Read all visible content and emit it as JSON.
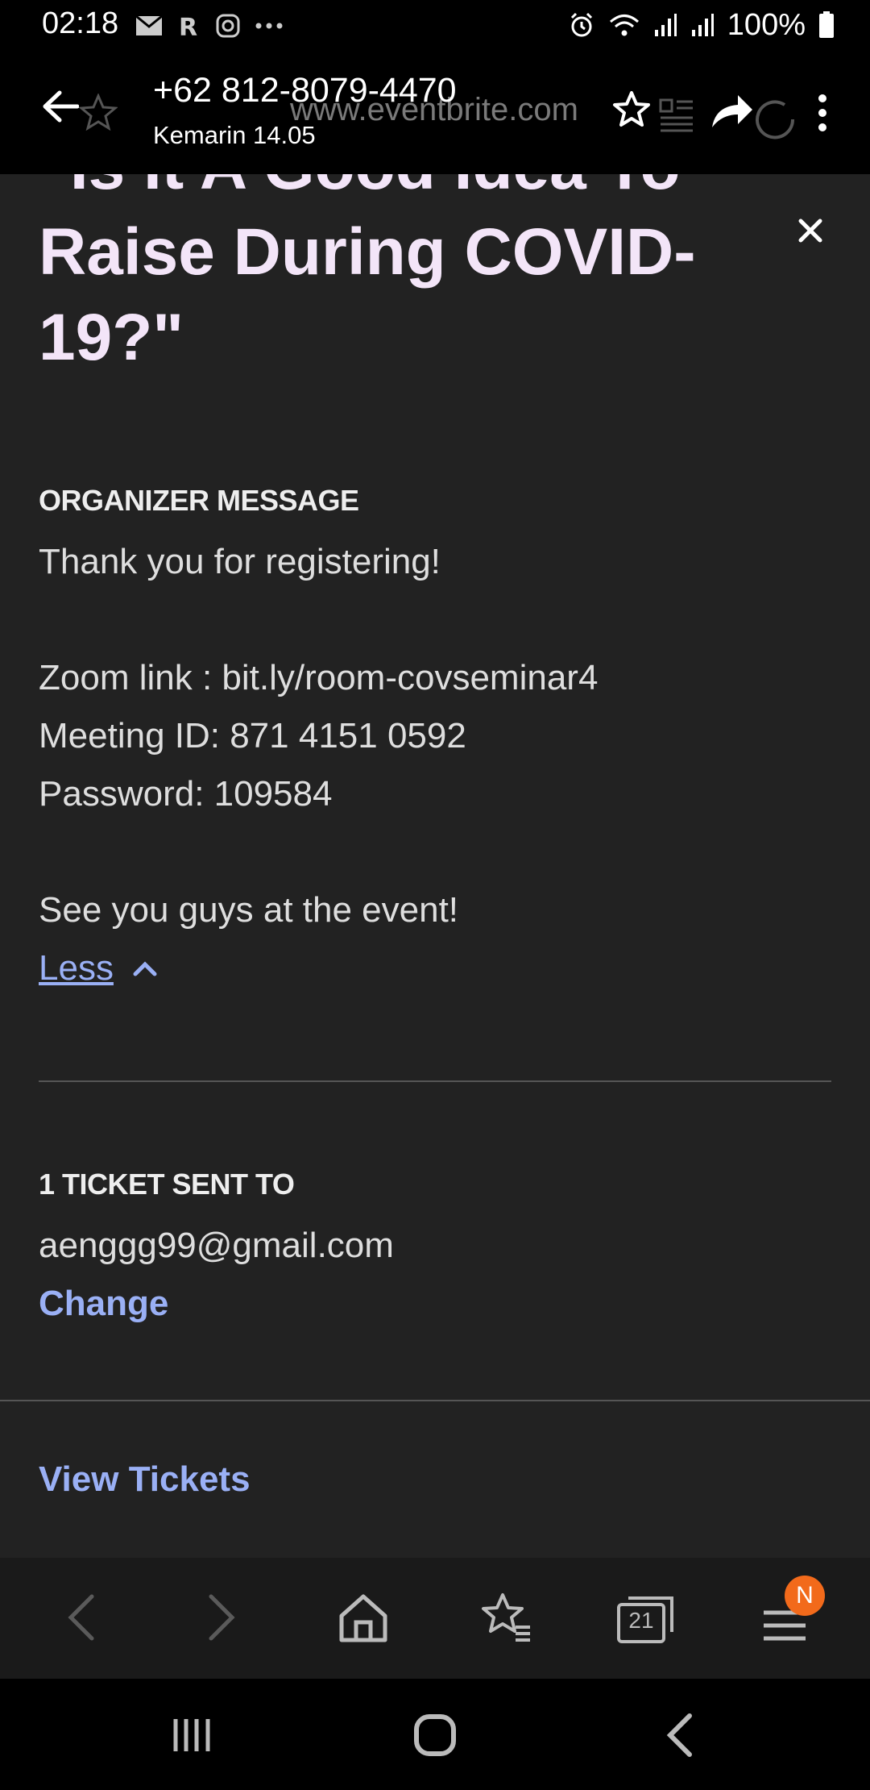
{
  "status_bar": {
    "time": "02:18",
    "battery": "100%"
  },
  "top_bar": {
    "title": "+62 812-8079-4470",
    "subtitle": "Kemarin 14.05",
    "ghost_url": "www.eventbrite.com"
  },
  "event": {
    "title_line_partial": "\"Is It A Good Idea To",
    "title_line_2": "Raise During COVID-",
    "title_line_3": "19?\""
  },
  "organizer": {
    "heading": "ORGANIZER MESSAGE",
    "lines": [
      "Thank you for registering!",
      "Zoom link : bit.ly/room-covseminar4",
      "Meeting ID: 871 4151 0592",
      "Password: 109584",
      "See you guys at the event!"
    ],
    "less_label": "Less"
  },
  "ticket": {
    "heading": "1 TICKET SENT TO",
    "email": "aenggg99@gmail.com",
    "change_label": "Change"
  },
  "view_tickets_label": "View Tickets",
  "browser_nav": {
    "tabs_count": "21",
    "menu_badge": "N"
  },
  "colors": {
    "accent_link": "#9ab0f5",
    "title": "#f3e5f8",
    "badge": "#f26a1b"
  }
}
